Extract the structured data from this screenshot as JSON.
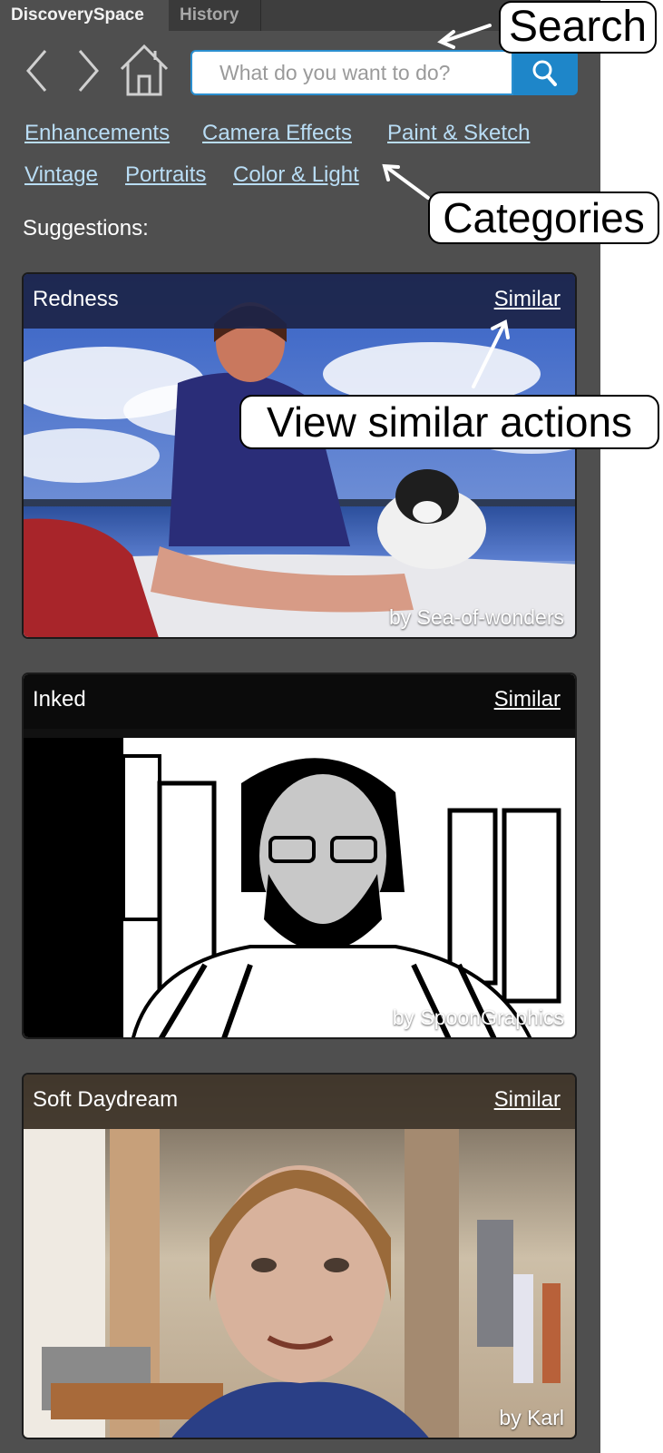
{
  "tabs": [
    {
      "label": "DiscoverySpace",
      "active": true
    },
    {
      "label": "History",
      "active": false
    }
  ],
  "search": {
    "placeholder": "What do you want to do?"
  },
  "categories": [
    "Enhancements",
    "Camera Effects",
    "Paint & Sketch",
    "Vintage",
    "Portraits",
    "Color & Light"
  ],
  "suggestions_label": "Suggestions:",
  "cards": [
    {
      "title": "Redness",
      "similar": "Similar",
      "credit": "by Sea-of-wonders"
    },
    {
      "title": "Inked",
      "similar": "Similar",
      "credit": "by SpoonGraphics"
    },
    {
      "title": "Soft Daydream",
      "similar": "Similar",
      "credit": "by Karl"
    }
  ],
  "callouts": {
    "search": "Search",
    "categories": "Categories",
    "similar": "View similar actions"
  },
  "colors": {
    "panel_bg": "#4f4f4f",
    "link": "#b9ddf5",
    "search_accent": "#1e86c9"
  }
}
